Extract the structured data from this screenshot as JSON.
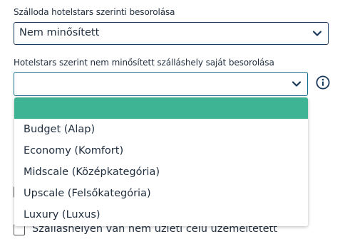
{
  "fields": {
    "hotelstars_label": "Szálloda hotelstars szerinti besorolása",
    "hotelstars_value": "Nem minősített",
    "own_rating_label": "Hotelstars szerint nem minősített szálláshely saját besorolása",
    "own_rating_value": ""
  },
  "dropdown": {
    "options": [
      "",
      "Budget (Alap)",
      "Economy (Komfort)",
      "Midscale (Középkategória)",
      "Upscale (Felsőkategória)",
      "Luxury (Luxus)"
    ],
    "selected_index": 0
  },
  "checkboxes": [
    {
      "label": "",
      "checked": false
    },
    {
      "label": "Szálláshelyen van nem üzleti célú üzemeltetett",
      "checked": false
    }
  ],
  "colors": {
    "selected_option": "#3fb494",
    "border": "#1a3a5c",
    "text": "#1f2d3d"
  },
  "icons": {
    "select_arrow": "chevron-down-icon",
    "info": "info-icon"
  }
}
